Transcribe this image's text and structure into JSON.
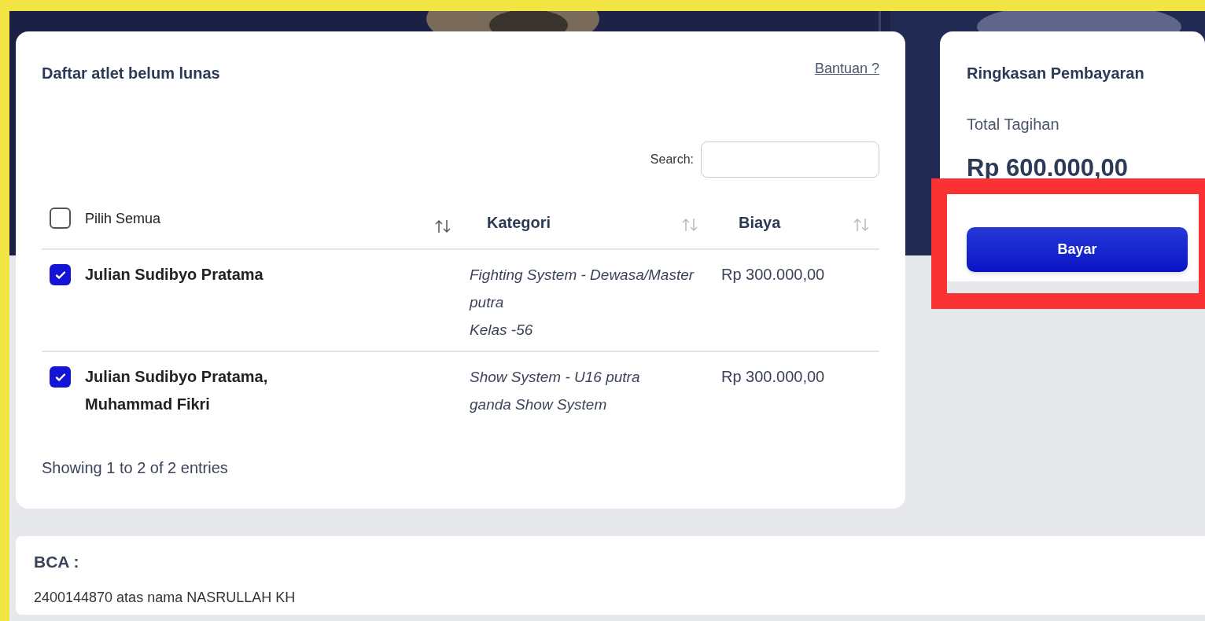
{
  "table_card": {
    "title": "Daftar atlet belum lunas",
    "help_link": "Bantuan ?",
    "search": {
      "label": "Search:"
    },
    "select_all": {
      "label": "Pilih Semua",
      "checked": false
    },
    "columns": [
      {
        "label": "Kategori"
      },
      {
        "label": "Biaya"
      }
    ],
    "rows": [
      {
        "checked": true,
        "names": [
          "Julian Sudibyo Pratama"
        ],
        "category": [
          "Fighting System - Dewasa/Master",
          "putra",
          "Kelas -56"
        ],
        "fee": "Rp 300.000,00"
      },
      {
        "checked": true,
        "names": [
          "Julian Sudibyo Pratama,",
          "Muhammad Fikri"
        ],
        "category": [
          "Show System - U16 putra",
          "ganda Show System"
        ],
        "fee": "Rp 300.000,00"
      }
    ],
    "footer": "Showing 1 to 2 of 2 entries"
  },
  "summary_card": {
    "title": "Ringkasan Pembayaran",
    "total_label": "Total Tagihan",
    "total": "Rp 600.000,00",
    "pay_button": "Bayar",
    "highlighted": true
  },
  "bank": {
    "label": "BCA :",
    "account": "2400144870 atas nama NASRULLAH KH"
  }
}
